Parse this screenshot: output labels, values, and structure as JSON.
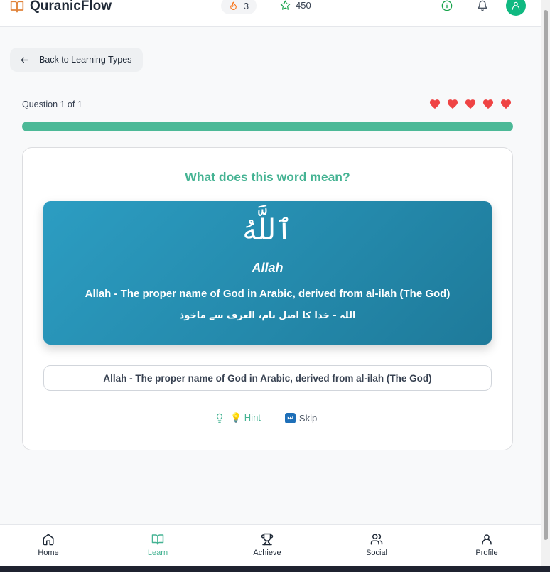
{
  "header": {
    "app_name": "QuranicFlow",
    "streak_count": "3",
    "stars_count": "450"
  },
  "back_button": {
    "label": "Back to Learning Types"
  },
  "quiz": {
    "progress_label": "Question 1 of 1",
    "progress_fraction": 1.0,
    "hearts_remaining": 5,
    "question": "What does this word mean?",
    "arabic_word": "ٱللَّهُ",
    "transliteration": "Allah",
    "meaning_en": "Allah - The proper name of God in Arabic, derived from al-ilah (The God)",
    "meaning_ur": "اللہ - خدا کا اصل نام، العرف سے ماخوذ",
    "answer_option": "Allah - The proper name of God in Arabic, derived from al-ilah (The God)",
    "hint_label": "💡 Hint",
    "skip_label": "Skip"
  },
  "nav": {
    "home": "Home",
    "learn": "Learn",
    "achieve": "Achieve",
    "social": "Social",
    "profile": "Profile"
  },
  "colors": {
    "accent": "#45b393",
    "panel_gradient_start": "#2c9dc2",
    "panel_gradient_end": "#1e7a9a",
    "heart": "#ef4444",
    "avatar": "#10b981"
  }
}
